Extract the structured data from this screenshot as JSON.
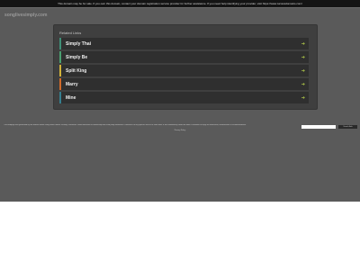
{
  "notice": "This domain may be for sale. If you own this domain, contact your domain registration service provider for further assistance. If you need help identifying your provider, visit https://www.tucowsdomains.com/",
  "domain": "songlivesimply.com",
  "related": {
    "label": "Related Links",
    "items": [
      {
        "label": "Simply Thai",
        "accent": "#3f8f77"
      },
      {
        "label": "Simply Be",
        "accent": "#4aa070"
      },
      {
        "label": "Split King",
        "accent": "#d2b33a"
      },
      {
        "label": "Marry",
        "accent": "#d06a2a"
      },
      {
        "label": "Mine",
        "accent": "#357f8f"
      }
    ],
    "arrow": "➔"
  },
  "footer": {
    "text": "This webpage was generated by the domain owner using Sedo Domain Parking. Disclaimer: Sedo maintains no relationship with third party advertisers. Reference to any specific service or trade mark is not controlled by Sedo nor does it constitute or imply its association, endorsement or recommendation.",
    "search_placeholder": "",
    "search_button": "Search Ads",
    "privacy": "Privacy Policy"
  }
}
